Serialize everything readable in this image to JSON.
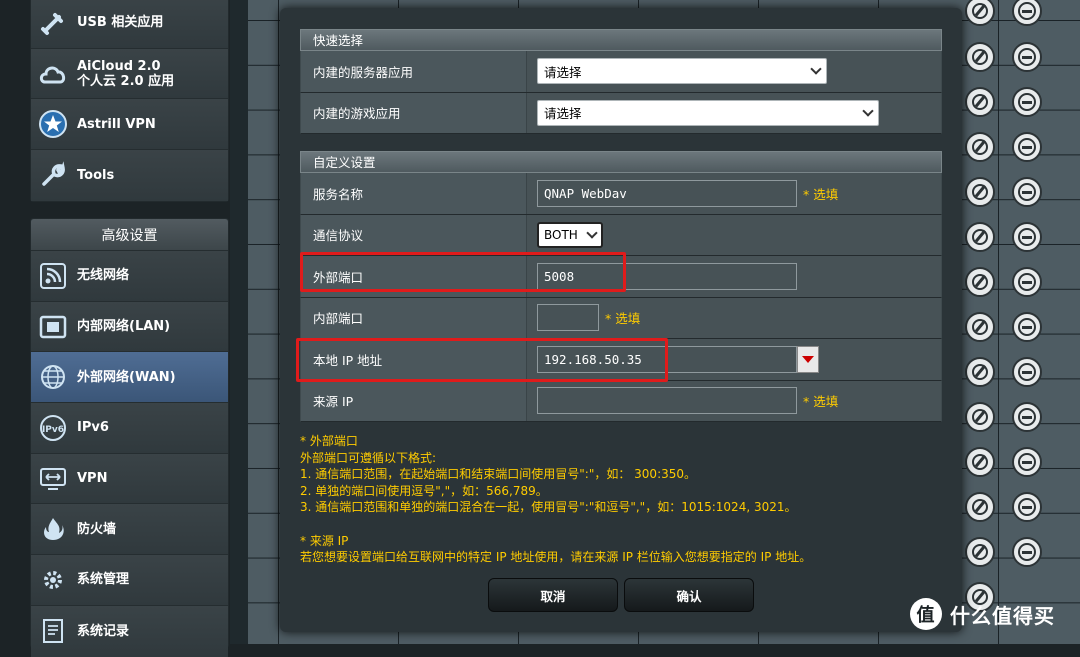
{
  "sidebar": {
    "top_items": [
      {
        "label": "USB 相关应用",
        "icon": "usb-icon"
      },
      {
        "label": "AiCloud 2.0",
        "label2": "个人云 2.0 应用",
        "icon": "cloud-icon"
      },
      {
        "label": "Astrill VPN",
        "icon": "star-icon"
      },
      {
        "label": "Tools",
        "icon": "wrench-icon"
      }
    ],
    "advanced_header": "高级设置",
    "advanced_items": [
      {
        "label": "无线网络",
        "icon": "wireless-icon"
      },
      {
        "label": "内部网络(LAN)",
        "icon": "lan-icon"
      },
      {
        "label": "外部网络(WAN)",
        "icon": "globe-icon",
        "active": true
      },
      {
        "label": "IPv6",
        "icon": "ipv6-icon"
      },
      {
        "label": "VPN",
        "icon": "vpn-icon"
      },
      {
        "label": "防火墙",
        "icon": "firewall-icon"
      },
      {
        "label": "系统管理",
        "icon": "gear-icon"
      },
      {
        "label": "系统记录",
        "icon": "log-icon"
      }
    ]
  },
  "quick": {
    "header": "快速选择",
    "server_label": "内建的服务器应用",
    "server_value": "请选择",
    "game_label": "内建的游戏应用",
    "game_value": "请选择"
  },
  "custom": {
    "header": "自定义设置",
    "service_label": "服务名称",
    "service_value": "QNAP WebDav",
    "required": "* 选填",
    "protocol_label": "通信协议",
    "protocol_value": "BOTH",
    "ext_port_label": "外部端口",
    "ext_port_value": "5008",
    "int_port_label": "内部端口",
    "int_port_value": "",
    "local_ip_label": "本地 IP 地址",
    "local_ip_value": "192.168.50.35",
    "source_ip_label": "来源 IP",
    "source_ip_value": ""
  },
  "notes": {
    "line1": "* 外部端口",
    "line2": "外部端口可遵循以下格式:",
    "line3": "1. 通信端口范围，在起始端口和结束端口间使用冒号\":\"，如：  300:350。",
    "line4": "2. 单独的端口间使用逗号\",\"，如：566,789。",
    "line5": "3. 通信端口范围和单独的端口混合在一起，使用冒号\":\"和逗号\",\"，如：1015:1024, 3021。",
    "line6": "* 来源 IP",
    "line7": "若您想要设置端口给互联网中的特定 IP 地址使用，请在来源 IP 栏位输入您想要指定的 IP 地址。"
  },
  "buttons": {
    "cancel": "取消",
    "ok": "确认"
  },
  "watermark": {
    "text": "什么值得买",
    "logo": "值"
  },
  "colors": {
    "accent_red": "#e01b1b",
    "note_yellow": "#ffcc00",
    "active_blue": "#4f6d94"
  }
}
